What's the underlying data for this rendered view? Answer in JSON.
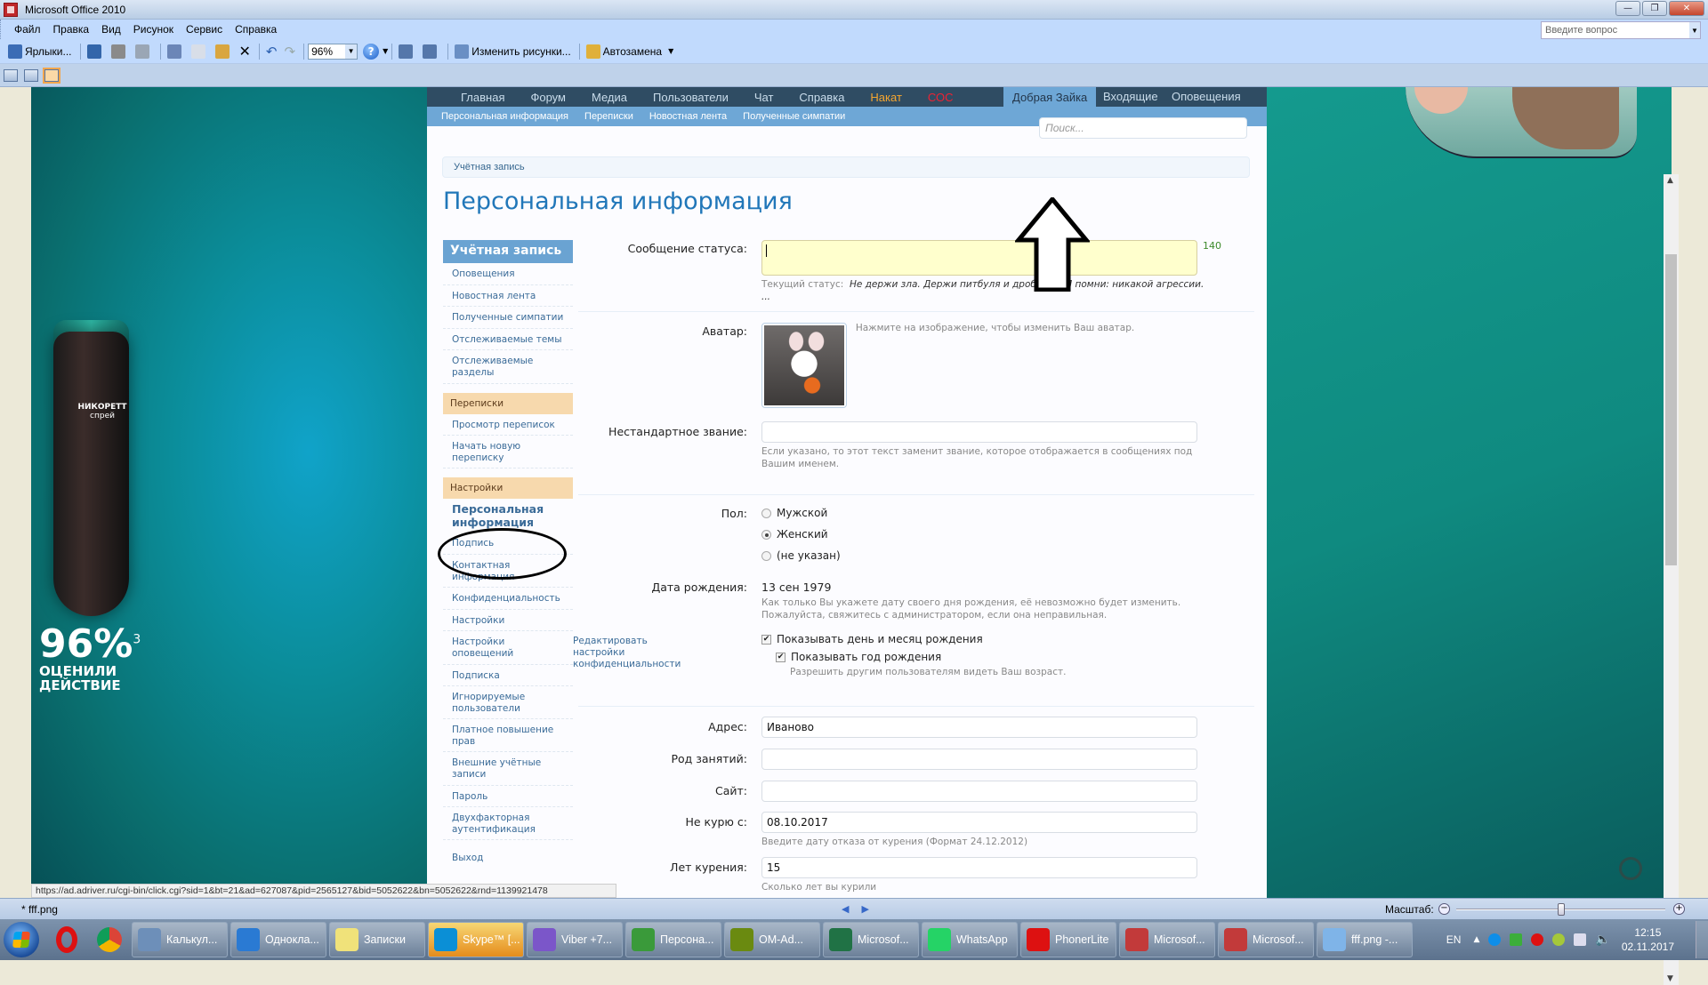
{
  "window": {
    "title": "Microsoft Office 2010",
    "ask_placeholder": "Введите вопрос"
  },
  "menu": [
    "Файл",
    "Правка",
    "Вид",
    "Рисунок",
    "Сервис",
    "Справка"
  ],
  "toolbar": {
    "shortcuts_label": "Ярлыки...",
    "zoom_value": "96%",
    "edit_pictures_label": "Изменить рисунки...",
    "autocorrect_label": "Автозамена"
  },
  "ad_left": {
    "brand": "НИКОРЕТТ",
    "product": "спрей",
    "percent": "96%",
    "footnote": "3",
    "caption_line1": "ОЦЕНИЛИ",
    "caption_line2": "ДЕЙСТВИЕ"
  },
  "site": {
    "nav": [
      "Главная",
      "Форум",
      "Медиа",
      "Пользователи",
      "Чат",
      "Справка",
      "Накат",
      "СОС"
    ],
    "user_tab": "Добрая Зайка",
    "inbox_tab": "Входящие",
    "alerts_tab": "Оповещения",
    "subnav": [
      "Персональная информация",
      "Переписки",
      "Новостная лента",
      "Полученные симпатии"
    ],
    "search_placeholder": "Поиск...",
    "breadcrumb": "Учётная запись",
    "page_title": "Персональная информация"
  },
  "sidebar": {
    "header": "Учётная запись",
    "account_items": [
      "Оповещения",
      "Новостная лента",
      "Полученные симпатии",
      "Отслеживаемые темы",
      "Отслеживаемые разделы"
    ],
    "conversations_header": "Переписки",
    "conversation_items": [
      "Просмотр переписок",
      "Начать новую переписку"
    ],
    "settings_header": "Настройки",
    "current_item": "Персональная информация",
    "settings_items": [
      "Подпись",
      "Контактная информация",
      "Конфиденциальность",
      "Настройки",
      "Настройки оповещений",
      "Подписка",
      "Игнорируемые пользователи",
      "Платное повышение прав",
      "Внешние учётные записи",
      "Пароль",
      "Двухфакторная аутентификация"
    ],
    "logout": "Выход"
  },
  "form": {
    "status_label": "Сообщение статуса:",
    "status_value": "",
    "status_counter": "140",
    "current_status_label": "Текущий статус:",
    "current_status_value": "Не держи зла. Держи питбуля и дробовик. И помни: никакой агрессии. ...",
    "avatar_label": "Аватар:",
    "avatar_note": "Нажмите на изображение, чтобы изменить Ваш аватар.",
    "custom_title_label": "Нестандартное звание:",
    "custom_title_value": "",
    "custom_title_hint": "Если указано, то этот текст заменит звание, которое отображается в сообщениях под Вашим именем.",
    "gender_label": "Пол:",
    "gender_options": [
      "Мужской",
      "Женский",
      "(не указан)"
    ],
    "gender_selected": "Женский",
    "dob_label": "Дата рождения:",
    "dob_value": "13 сен 1979",
    "dob_hint": "Как только Вы укажете дату своего дня рождения, её невозможно будет изменить. Пожалуйста, свяжитесь с администратором, если она неправильная.",
    "privacy_link": "Редактировать настройки конфиденциальности",
    "show_dob_label": "Показывать день и месяц рождения",
    "show_dob_checked": true,
    "show_year_label": "Показывать год рождения",
    "show_year_checked": true,
    "show_year_hint": "Разрешить другим пользователям видеть Ваш возраст.",
    "location_label": "Адрес:",
    "location_value": "Иваново",
    "occupation_label": "Род занятий:",
    "occupation_value": "",
    "website_label": "Сайт:",
    "website_value": "",
    "quit_label": "Не курю с:",
    "quit_value": "08.10.2017",
    "quit_hint": "Введите дату отказа от курения (Формат 24.12.2012)",
    "years_label": "Лет курения:",
    "years_value": "15",
    "years_hint": "Сколько лет вы курили"
  },
  "link_preview": "https://ad.adriver.ru/cgi-bin/click.cgi?sid=1&bt=21&ad=627087&pid=2565127&bid=5052622&bn=5052622&rnd=1139921478",
  "statusbar": {
    "filename": "* fff.png",
    "zoom_label": "Масштаб:",
    "zoom_slider_fraction": 0.5
  },
  "taskbar": {
    "tasks": [
      {
        "label": "Калькул...",
        "color": "#6d8fb9"
      },
      {
        "label": "Однокла...",
        "color": "#2a7ad3"
      },
      {
        "label": "Записки",
        "color": "#f0e27a"
      },
      {
        "label": "Skype™ [...",
        "color": "#0b8fd6",
        "highlight": true
      },
      {
        "label": "Viber +7...",
        "color": "#7b56c9"
      },
      {
        "label": "Персона...",
        "color": "#3a9a3a"
      },
      {
        "label": "OM-Ad...",
        "color": "#6a8a10"
      },
      {
        "label": "Microsof...",
        "color": "#207245"
      },
      {
        "label": "WhatsApp",
        "color": "#25d366"
      },
      {
        "label": "PhonerLite",
        "color": "#d11"
      },
      {
        "label": "Microsof...",
        "color": "#c23a3a"
      },
      {
        "label": "Microsof...",
        "color": "#c23a3a"
      },
      {
        "label": "fff.png -...",
        "color": "#7fb4e8"
      }
    ],
    "lang": "EN",
    "time": "12:15",
    "date": "02.11.2017"
  }
}
